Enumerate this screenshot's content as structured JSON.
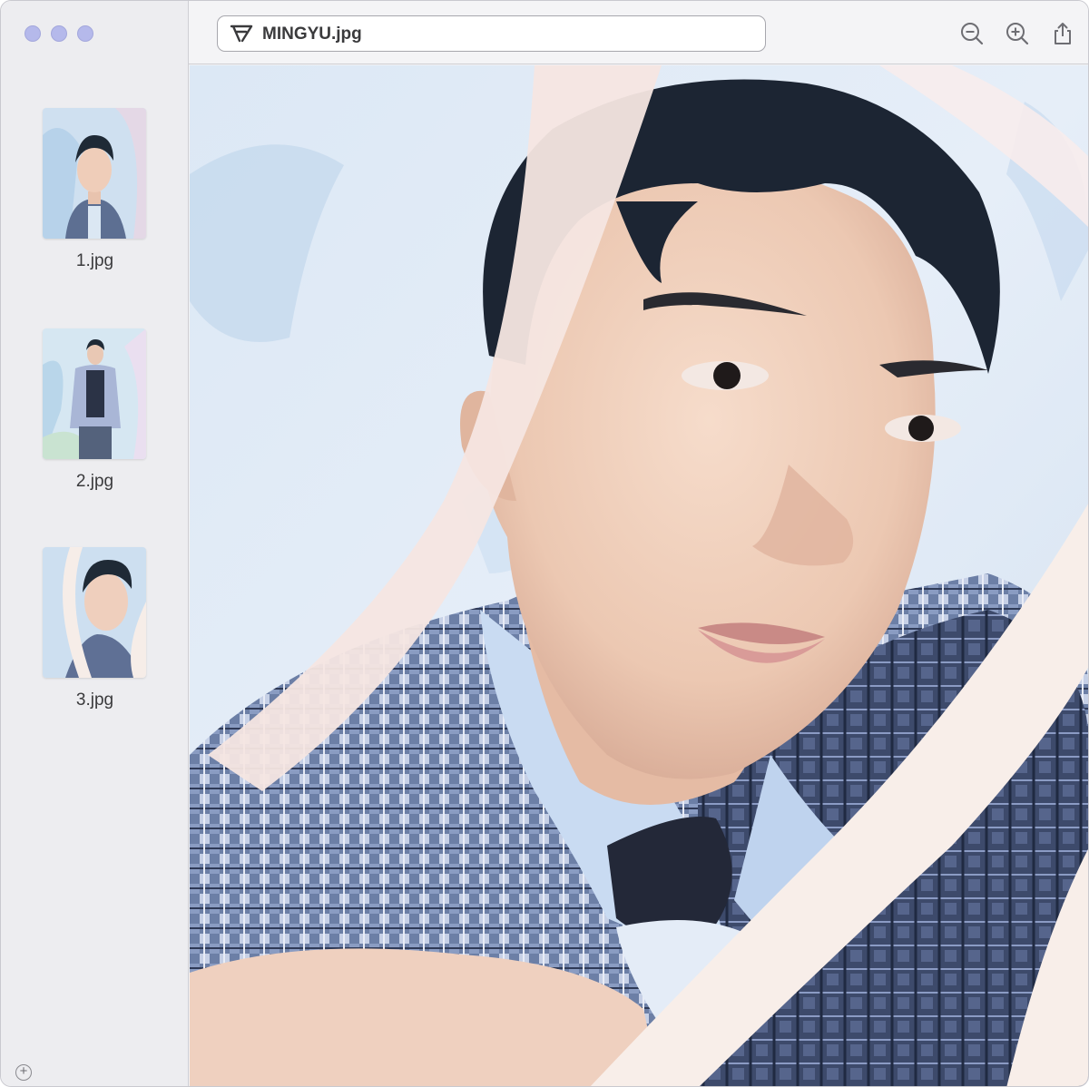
{
  "window": {
    "traffic_lights": [
      "close",
      "minimize",
      "zoom"
    ],
    "accent_color": "#b5b9eb"
  },
  "toolbar": {
    "title": "MINGYU.jpg",
    "logo_icon": "seventeen-logo-icon",
    "buttons": [
      {
        "name": "zoom-out-button",
        "icon": "zoom-out-icon"
      },
      {
        "name": "zoom-in-button",
        "icon": "zoom-in-icon"
      },
      {
        "name": "share-button",
        "icon": "share-icon"
      }
    ]
  },
  "sidebar": {
    "thumbnails": [
      {
        "label": "1.jpg"
      },
      {
        "label": "2.jpg"
      },
      {
        "label": "3.jpg"
      }
    ],
    "add_icon": "plus-circle-icon"
  },
  "viewer": {
    "image": "portrait-photo"
  }
}
